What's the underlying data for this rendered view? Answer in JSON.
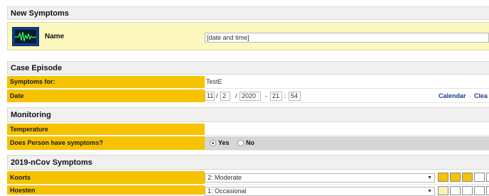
{
  "new_symptoms": {
    "title": "New Symptoms",
    "name_label": "Name",
    "name_value": "[date and time]"
  },
  "case_episode": {
    "title": "Case Episode",
    "symptoms_for_label": "Symptoms for:",
    "symptoms_for_value": "TestE",
    "date_label": "Date",
    "date_day": "11",
    "date_month": "2",
    "date_year": "2020",
    "date_hour": "21",
    "date_minute": "54",
    "sep_slash": "/",
    "sep_dash": "-",
    "sep_colon": ":",
    "calendar_link": "Calendar",
    "link_separator": "-",
    "clear_link": "Clea"
  },
  "monitoring": {
    "title": "Monitoring",
    "temperature_label": "Temperature",
    "temperature_value": "",
    "symptoms_question": "Does Person have symptoms?",
    "option_yes": "Yes",
    "option_no": "No",
    "selected": "Yes"
  },
  "ncov": {
    "title": "2019-nCov Symptoms",
    "rows": [
      {
        "label": "Koorts",
        "value": "2: Moderate",
        "level": 3
      },
      {
        "label": "Hoesten",
        "value": "1: Occasional",
        "level": 1
      }
    ]
  },
  "colors": {
    "label_bg": "#f7c200",
    "section_bg": "#f0f0f0",
    "name_row_bg": "#fdf8c0",
    "link": "#1a3c8c",
    "level_filled": "#f7c200",
    "level_filled_light": "#f9f1b8"
  },
  "icons": {
    "name_icon": "heartbeat-monitor-icon",
    "select_arrow": "dropdown-arrow-icon"
  }
}
